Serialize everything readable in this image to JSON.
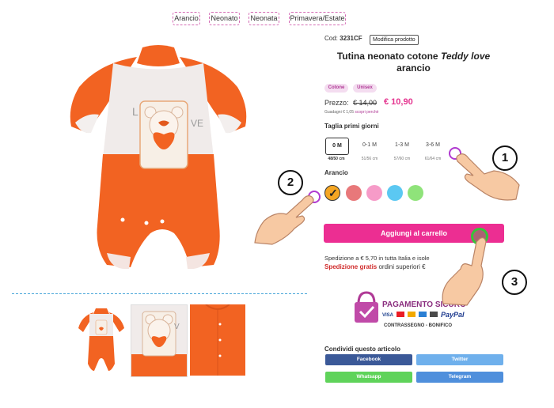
{
  "categories": [
    "Arancio",
    "Neonato",
    "Neonata",
    "Primavera/Estate"
  ],
  "product": {
    "code_label": "Cod:",
    "code_value": "3231CF",
    "edit_label": "Modifica prodotto",
    "title_prefix": "Tutina neonato cotone",
    "title_italic": "Teddy love",
    "title_suffix": "arancio",
    "badges": [
      "Cotone",
      "Unisex"
    ],
    "price_label": "Prezzo:",
    "old_price": "€ 14,00",
    "new_price": "€ 10,90",
    "savings_text": "Guadagni € 1,05",
    "savings_link": "scopri perchè"
  },
  "sizes": {
    "heading": "Taglia primi giorni",
    "options": [
      {
        "label": "0 M",
        "cm": "48/50 cm",
        "selected": true
      },
      {
        "label": "0-1 M",
        "cm": "51/56 cm",
        "selected": false
      },
      {
        "label": "1-3 M",
        "cm": "57/60 cm",
        "selected": false
      },
      {
        "label": "3-6 M",
        "cm": "61/64 cm",
        "selected": false
      }
    ]
  },
  "colors": {
    "heading": "Arancio",
    "swatches": [
      {
        "name": "Arancio",
        "hex": "#f5a623",
        "selected": true
      },
      {
        "name": "rosa",
        "hex": "#e8787a",
        "selected": false
      },
      {
        "name": "rosa chiaro",
        "hex": "#f69bc8",
        "selected": false
      },
      {
        "name": "azzurro",
        "hex": "#5bc8f2",
        "selected": false
      },
      {
        "name": "verde",
        "hex": "#8fe37a",
        "selected": false
      }
    ],
    "check_mark": "✓"
  },
  "cart_button": "Aggiungi al carrello",
  "shipping": {
    "line1": "Spedizione a € 5,70 in tutta Italia e isole",
    "line2_bold": "Spedizione gratis",
    "line2_rest": "ordini superiori €"
  },
  "payment": {
    "heading": "PAGAMENTO SICURO",
    "card_labels": [
      "VISA",
      "PayPal"
    ],
    "methods": "CONTRASSEGNO - BONIFICO"
  },
  "share": {
    "heading": "Condividi questo articolo",
    "buttons": [
      {
        "label": "Facebook",
        "color": "#3b5998"
      },
      {
        "label": "Twitter",
        "color": "#6fb0ec"
      },
      {
        "label": "Whatsapp",
        "color": "#5fd35a"
      },
      {
        "label": "Telegram",
        "color": "#4f8fdc"
      }
    ]
  },
  "annotations": [
    "1",
    "2",
    "3"
  ],
  "theme": {
    "accent": "#ec2e92",
    "orange": "#f26322",
    "link": "#49a6d8"
  }
}
